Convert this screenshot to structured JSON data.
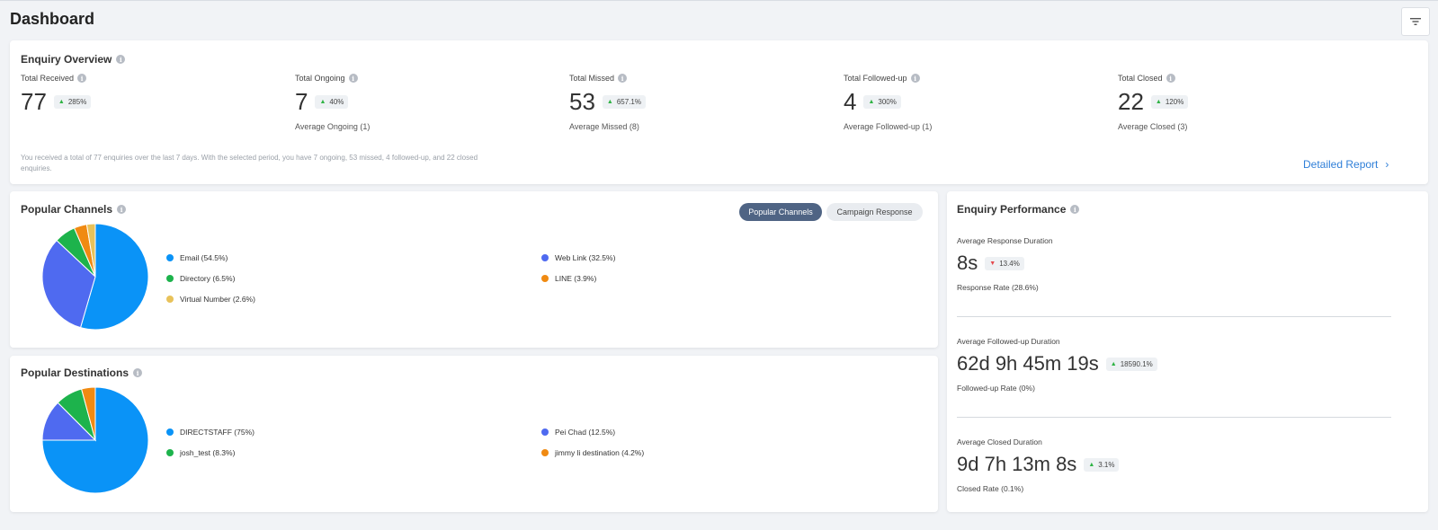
{
  "header": {
    "title": "Dashboard",
    "filter_icon": "filter-icon"
  },
  "overview": {
    "title": "Enquiry Overview",
    "stats": [
      {
        "label": "Total Received",
        "value": "77",
        "change": "285%",
        "direction": "up",
        "sub": ""
      },
      {
        "label": "Total Ongoing",
        "value": "7",
        "change": "40%",
        "direction": "up",
        "sub": "Average Ongoing (1)"
      },
      {
        "label": "Total Missed",
        "value": "53",
        "change": "657.1%",
        "direction": "up",
        "sub": "Average Missed (8)"
      },
      {
        "label": "Total Followed-up",
        "value": "4",
        "change": "300%",
        "direction": "up",
        "sub": "Average Followed-up (1)"
      },
      {
        "label": "Total Closed",
        "value": "22",
        "change": "120%",
        "direction": "up",
        "sub": "Average Closed (3)"
      }
    ],
    "summary": "You received a total of 77 enquiries over the last 7 days. With the selected period, you have 7 ongoing, 53 missed, 4 followed-up, and 22 closed enquiries.",
    "detail_link": "Detailed Report"
  },
  "channels": {
    "title": "Popular Channels",
    "tabs": {
      "active": "Popular Channels",
      "inactive": "Campaign Response"
    },
    "chart_data": {
      "type": "pie",
      "slices": [
        {
          "label": "Email (54.5%)",
          "value": 54.5,
          "color": "#0a93f7"
        },
        {
          "label": "Web Link (32.5%)",
          "value": 32.5,
          "color": "#4f6af0"
        },
        {
          "label": "Directory (6.5%)",
          "value": 6.5,
          "color": "#1db34c"
        },
        {
          "label": "LINE (3.9%)",
          "value": 3.9,
          "color": "#f08a12"
        },
        {
          "label": "Virtual Number (2.6%)",
          "value": 2.6,
          "color": "#e8c25a"
        }
      ]
    }
  },
  "destinations": {
    "title": "Popular Destinations",
    "chart_data": {
      "type": "pie",
      "slices": [
        {
          "label": "DIRECTSTAFF (75%)",
          "value": 75,
          "color": "#0a93f7"
        },
        {
          "label": "Pei Chad (12.5%)",
          "value": 12.5,
          "color": "#4f6af0"
        },
        {
          "label": "josh_test (8.3%)",
          "value": 8.3,
          "color": "#1db34c"
        },
        {
          "label": "jimmy li destination (4.2%)",
          "value": 4.2,
          "color": "#f08a12"
        }
      ]
    }
  },
  "performance": {
    "title": "Enquiry Performance",
    "blocks": [
      {
        "label": "Average Response Duration",
        "value": "8s",
        "change": "13.4%",
        "direction": "down",
        "sub": "Response Rate (28.6%)"
      },
      {
        "label": "Average Followed-up Duration",
        "value": "62d 9h 45m 19s",
        "change": "18590.1%",
        "direction": "up",
        "sub": "Followed-up Rate (0%)"
      },
      {
        "label": "Average Closed Duration",
        "value": "9d 7h 13m 8s",
        "change": "3.1%",
        "direction": "up",
        "sub": "Closed Rate (0.1%)"
      }
    ]
  },
  "colors": {
    "up": "#2fb344",
    "down": "#e5484d",
    "link": "#2f7fd8",
    "active_tab": "#4f6484"
  }
}
